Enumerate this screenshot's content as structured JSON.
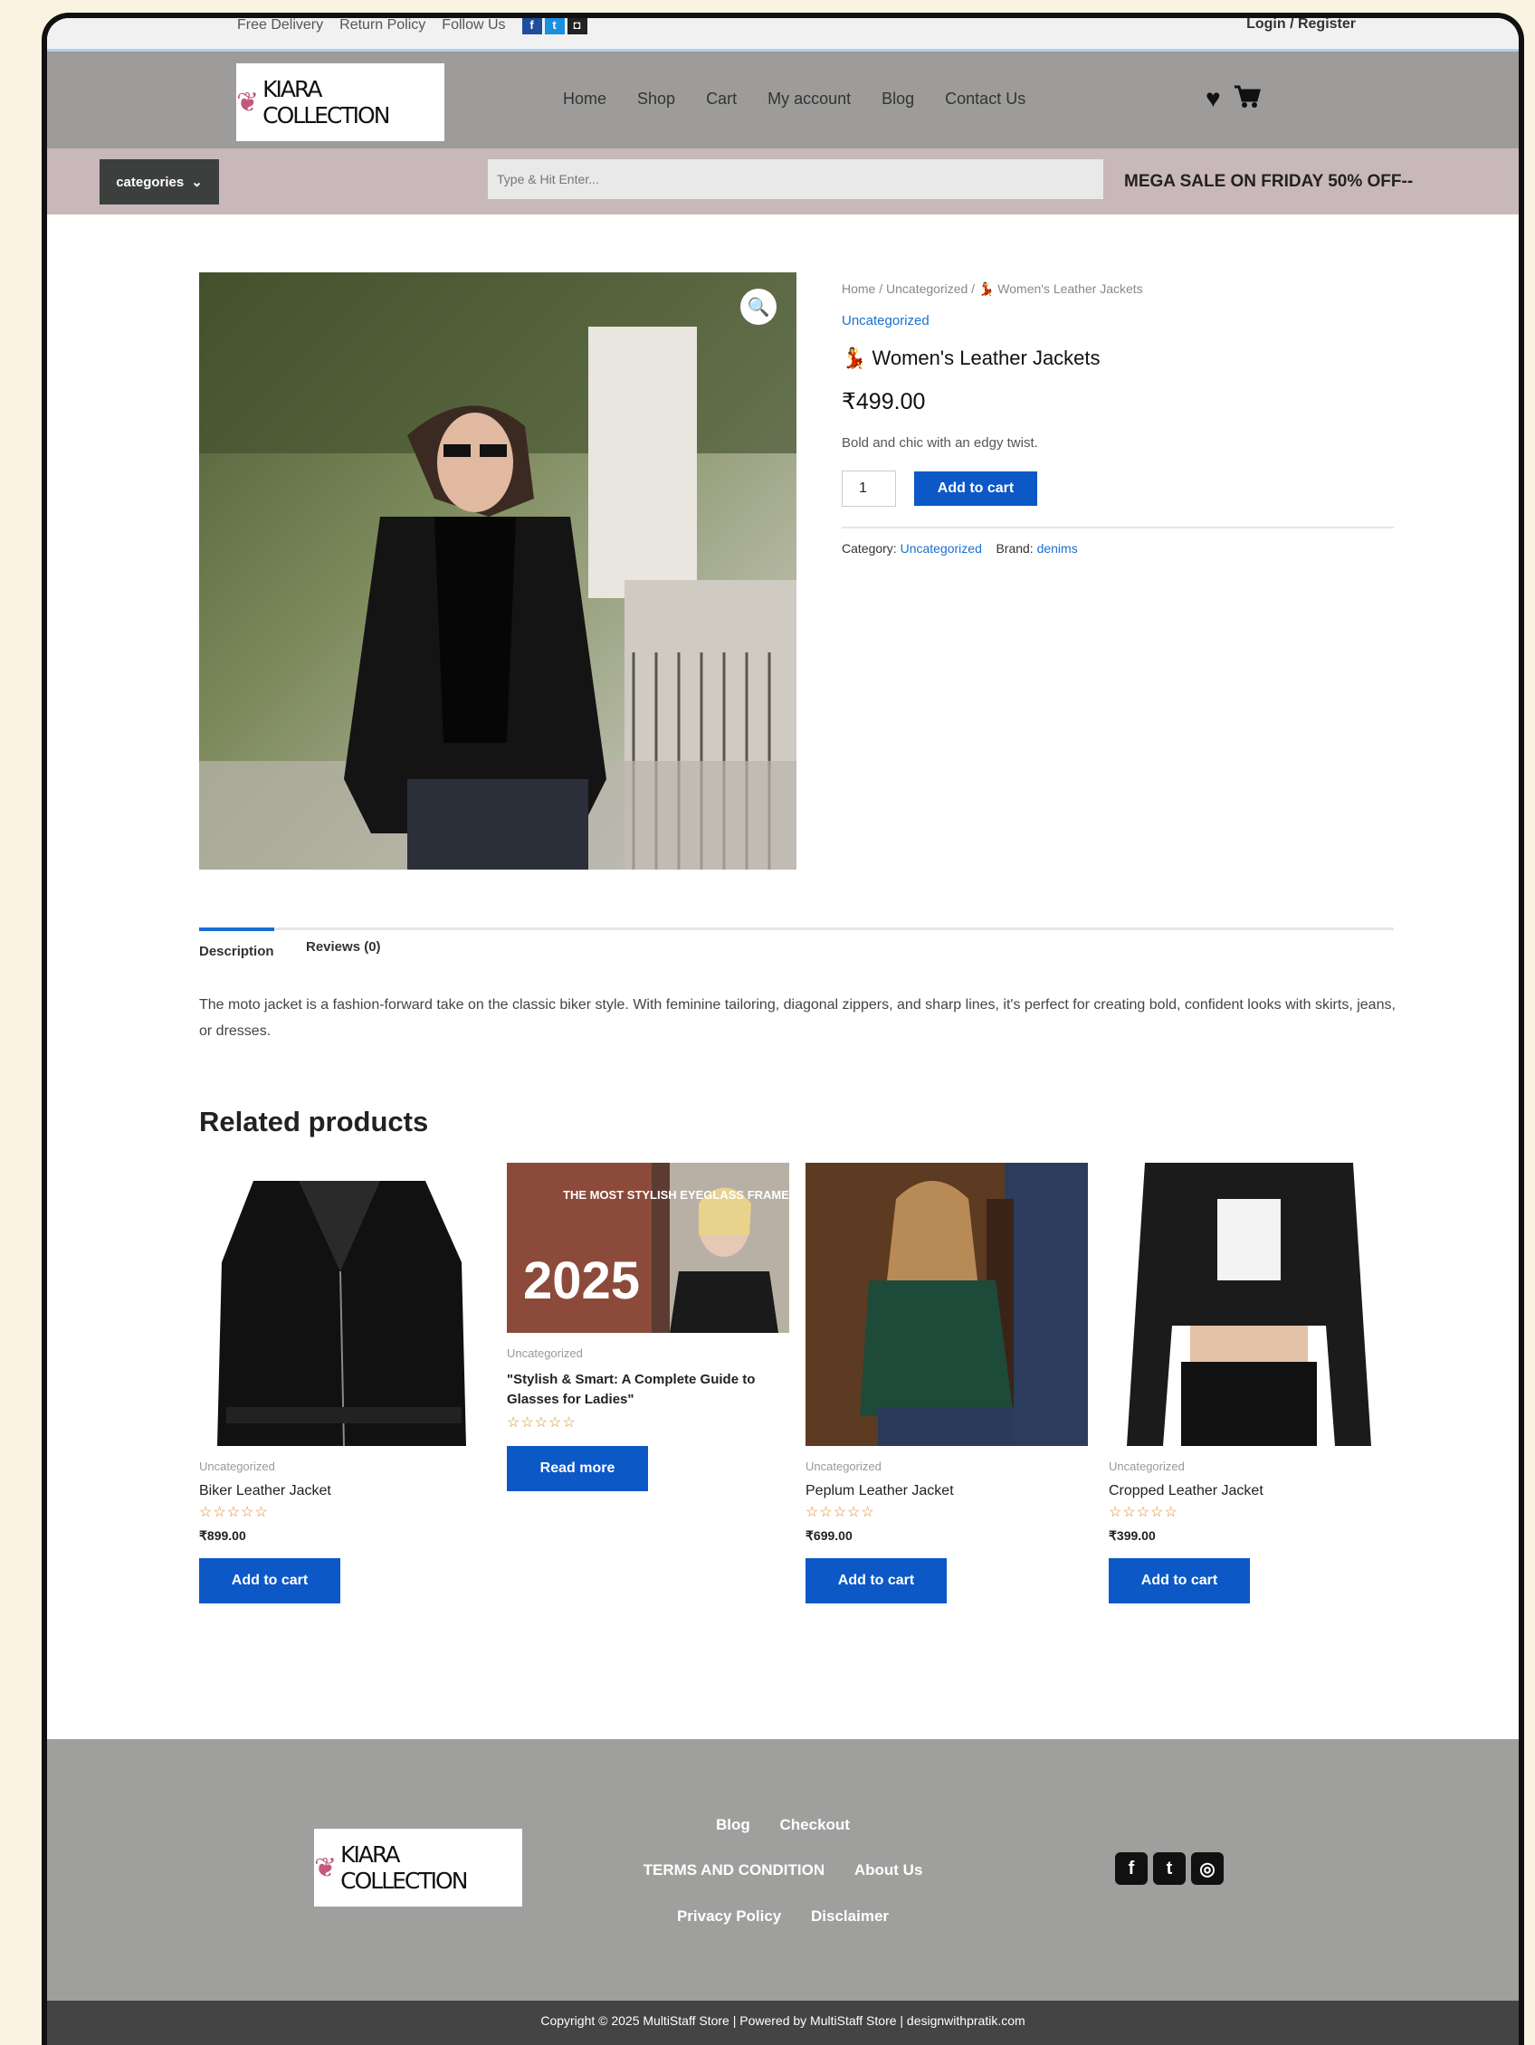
{
  "topbar": {
    "free_delivery": "Free Delivery",
    "return_policy": "Return Policy",
    "follow_us": "Follow Us",
    "login": "Login / Register"
  },
  "header": {
    "logo_text": "KIARA COLLECTION",
    "nav": [
      "Home",
      "Shop",
      "Cart",
      "My account",
      "Blog",
      "Contact Us"
    ],
    "wishlist_icon": "heart-icon",
    "cart_icon": "cart-icon"
  },
  "catbar": {
    "categories_label": "categories",
    "search_placeholder": "Type & Hit Enter...",
    "promo": "MEGA SALE ON FRIDAY 50% OFF--"
  },
  "product": {
    "breadcrumb": "Home / Uncategorized / 💃 Women's Leather Jackets",
    "category": "Uncategorized",
    "title": "💃 Women's Leather Jackets",
    "price": "₹499.00",
    "short_desc": "Bold and chic with an edgy twist.",
    "qty": "1",
    "add_to_cart": "Add to cart",
    "meta_category_label": "Category:",
    "meta_category": "Uncategorized",
    "meta_brand_label": "Brand:",
    "meta_brand": "denims"
  },
  "tabs": {
    "description": "Description",
    "reviews": "Reviews (0)"
  },
  "description_text": "The moto jacket is a fashion-forward take on the classic biker style. With feminine tailoring, diagonal zippers, and sharp lines, it's perfect for creating bold, confident looks with skirts, jeans, or dresses.",
  "related": {
    "title": "Related products",
    "items": [
      {
        "category": "Uncategorized",
        "name": "Biker Leather Jacket",
        "stars": "☆☆☆☆☆",
        "price": "₹899.00",
        "button": "Add to cart"
      },
      {
        "category": "Uncategorized",
        "name": "\"Stylish & Smart: A Complete Guide to Glasses for Ladies\"",
        "stars": "☆☆☆☆☆",
        "button": "Read more",
        "banner_top": "THE MOST STYLISH EYEGLASS FRAMES FOR",
        "banner_year": "2025"
      },
      {
        "category": "Uncategorized",
        "name": "Peplum Leather Jacket",
        "stars": "☆☆☆☆☆",
        "price": "₹699.00",
        "button": "Add to cart"
      },
      {
        "category": "Uncategorized",
        "name": "Cropped Leather Jacket",
        "stars": "☆☆☆☆☆",
        "price": "₹399.00",
        "button": "Add to cart"
      }
    ]
  },
  "footer": {
    "logo_text": "KIARA COLLECTION",
    "row1": [
      "Blog",
      "Checkout"
    ],
    "row2": [
      "TERMS AND CONDITION",
      "About Us"
    ],
    "row3": [
      "Privacy Policy",
      "Disclaimer"
    ],
    "social": [
      "facebook-icon",
      "twitter-icon",
      "instagram-icon"
    ],
    "copyright": "Copyright © 2025 MultiStaff Store | Powered by MultiStaff Store | designwithpratik.com"
  }
}
